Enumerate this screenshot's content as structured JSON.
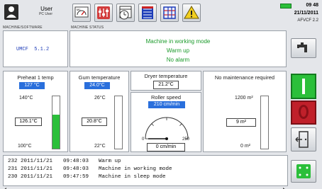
{
  "header": {
    "user_label": "User",
    "user_sub": "PC User",
    "machine_software_label": "MACHINE/SOFTWARE",
    "machine_status_label": "MACHINE STATUS",
    "time": "09 48",
    "date": "21/11/2011",
    "version": "AFVCF 2.2",
    "icons": [
      "user-icon",
      "gauge-icon",
      "mixer-icon",
      "clock-calendar-icon",
      "list-icon",
      "grid-icon",
      "warning-icon"
    ]
  },
  "machine": {
    "software": "UMCF  5.1.2"
  },
  "status": {
    "line1": "Machine in working mode",
    "line2": "Warm up",
    "line3": "No alarm"
  },
  "preheat": {
    "title": "Preheat 1 temp",
    "setpoint": "127 °C",
    "top": "140°C",
    "actual": "126.1°C",
    "bottom": "100°C",
    "fill_fraction": 0.65
  },
  "gum": {
    "title": "Gum temperature",
    "setpoint": "24.0°C",
    "top": "26°C",
    "actual": "20.8°C",
    "bottom": "22°C",
    "fill_fraction": 0.0
  },
  "dryer": {
    "title": "Dryer temperature",
    "value": "21.2°C"
  },
  "roller": {
    "title": "Roller speed",
    "setpoint": "210 cm/min",
    "scale_min": "0",
    "scale_max": "250",
    "actual": "0 cm/min",
    "value": 0
  },
  "maintenance": {
    "title": "No maintenance required",
    "top": "1200 m²",
    "actual": "9 m²",
    "bottom": "0 m²",
    "fill_fraction": 0.0
  },
  "log": [
    {
      "id": "232",
      "date": "2011/11/21",
      "time": "09:48:03",
      "msg": "Warm up"
    },
    {
      "id": "231",
      "date": "2011/11/21",
      "time": "09:48:03",
      "msg": "Machine in working mode"
    },
    {
      "id": "230",
      "date": "2011/11/21",
      "time": "09:47:59",
      "msg": "Machine in sleep mode"
    }
  ],
  "colors": {
    "accent_blue": "#2a6fdc",
    "status_green": "#1a9a2a",
    "start_green": "#2bbf3a",
    "stop_red": "#c0202a"
  }
}
